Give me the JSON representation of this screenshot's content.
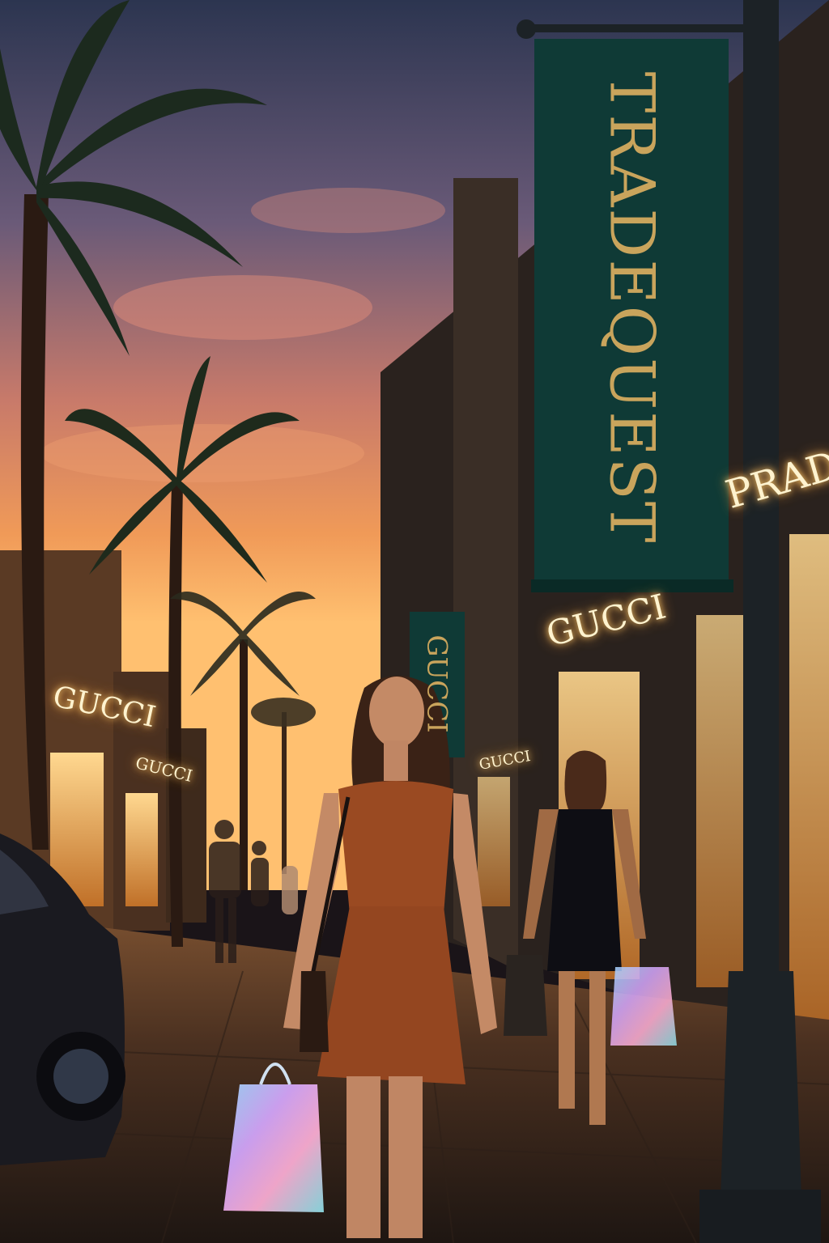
{
  "banner": {
    "text": "TRADEQUEST"
  },
  "small_banner": {
    "text": "GUCCI"
  },
  "signs": {
    "gucci_right": "GUCCI",
    "gucci_left": "GUCCI",
    "prada": "PRADA",
    "small_right": "GUCCI",
    "small_left": "GUCCI"
  },
  "colors": {
    "banner_green": "#0f3a36",
    "banner_gold": "#c9a45c",
    "sunset_orange": "#f08a3c",
    "dress_rust": "#9a4a22"
  }
}
